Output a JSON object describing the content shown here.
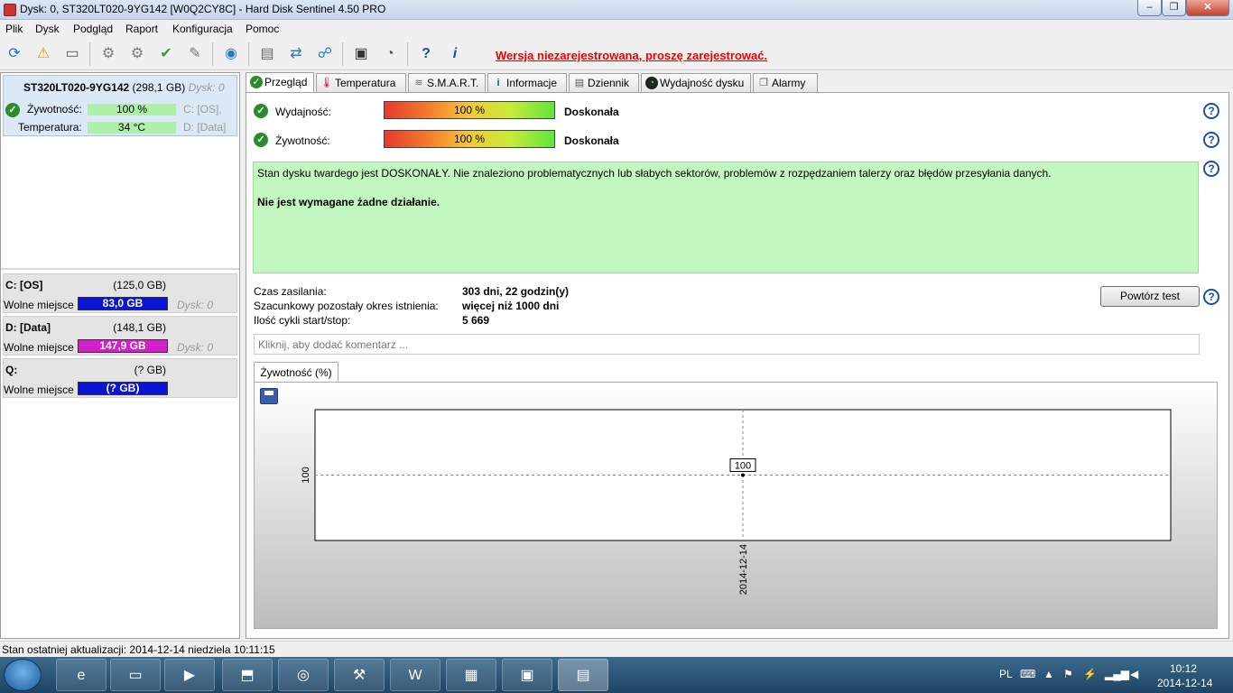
{
  "window": {
    "title": "Dysk: 0, ST320LT020-9YG142 [W0Q2CY8C]  -  Hard Disk Sentinel 4.50 PRO",
    "min_label": "–",
    "max_label": "❐",
    "close_label": "✕"
  },
  "menu": [
    "Plik",
    "Dysk",
    "Podgląd",
    "Raport",
    "Konfiguracja",
    "Pomoc"
  ],
  "toolbar": {
    "unregistered": "Wersja niezarejestrowana, proszę zarejestrować.",
    "icons": [
      "refresh-icon",
      "warning-icon",
      "disk-icon",
      "disk-tool-1-icon",
      "disk-tool-2-icon",
      "disk-tool-3-icon",
      "disk-tool-4-icon",
      "globe-icon",
      "document-icon",
      "sync-icon",
      "network-icon",
      "monitor-icon",
      "speaker-icon",
      "help-icon",
      "info-icon"
    ]
  },
  "disk": {
    "model": "ST320LT020-9YG142",
    "size": "(298,1 GB)",
    "disk_no": "Dysk: 0",
    "health_label": "Żywotność:",
    "health_value": "100 %",
    "health_parts": "C: [OS],",
    "temp_label": "Temperatura:",
    "temp_value": "34 °C",
    "temp_parts": "D: [Data]"
  },
  "partitions": [
    {
      "name": "C: [OS]",
      "size": "(125,0 GB)",
      "free_label": "Wolne miejsce",
      "free": "83,0 GB",
      "disk": "Dysk: 0",
      "color": "#0a14d4"
    },
    {
      "name": "D: [Data]",
      "size": "(148,1 GB)",
      "free_label": "Wolne miejsce",
      "free": "147,9 GB",
      "disk": "Dysk: 0",
      "color": "#d420c8"
    },
    {
      "name": "Q:",
      "size": "(? GB)",
      "free_label": "Wolne miejsce",
      "free": "(? GB)",
      "disk": "",
      "color": "#0a14d4"
    }
  ],
  "tabs": [
    "Przegląd",
    "Temperatura",
    "S.M.A.R.T.",
    "Informacje",
    "Dziennik",
    "Wydajność dysku",
    "Alarmy"
  ],
  "overview": {
    "perf_label": "Wydajność:",
    "perf_value": "100 %",
    "perf_rating": "Doskonała",
    "health_label": "Żywotność:",
    "health_value": "100 %",
    "health_rating": "Doskonała",
    "status_text": "Stan dysku twardego jest DOSKONAŁY. Nie znaleziono problematycznych lub słabych sektorów, problemów z rozpędzaniem talerzy oraz błędów przesyłania danych.",
    "action_text": "Nie jest wymagane żadne działanie.",
    "power_on_label": "Czas zasilania:",
    "power_on_value": "303 dni, 22 godzin(y)",
    "lifetime_label": "Szacunkowy pozostały okres istnienia:",
    "lifetime_value": "więcej niż 1000 dni",
    "cycles_label": "Ilość cykli start/stop:",
    "cycles_value": "5 669",
    "repeat_button": "Powtórz test",
    "comment_placeholder": "Kliknij, aby dodać komentarz ..."
  },
  "chart_tab": "Żywotność (%)",
  "chart_data": {
    "type": "line",
    "x": [
      "2014-12-14"
    ],
    "series": [
      {
        "values": [
          100
        ]
      }
    ],
    "data_labels": [
      "100"
    ],
    "y_ticks": [
      "100"
    ],
    "x_ticks": [
      "2014-12-14"
    ],
    "grid": true
  },
  "statusbar": "Stan ostatniej aktualizacji: 2014-12-14 niedziela 10:11:15",
  "taskbar": {
    "apps": [
      "ie-icon",
      "explorer-icon",
      "media-player-icon",
      "installer-icon",
      "chrome-icon",
      "tool-icon",
      "word-icon",
      "winrar-icon",
      "network-drive-icon",
      "hdsentinel-icon"
    ],
    "lang": "PL",
    "time": "10:12",
    "date": "2014-12-14"
  }
}
